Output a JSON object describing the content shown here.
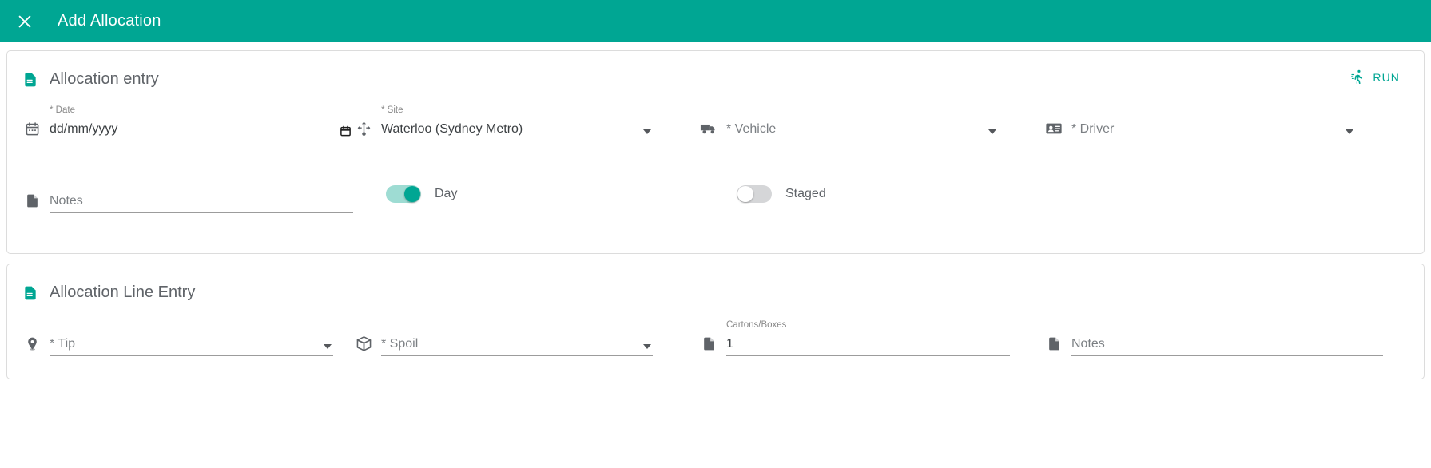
{
  "header": {
    "title": "Add Allocation",
    "close_icon": "close-icon",
    "background_color": "#00a693"
  },
  "allocation_entry": {
    "title": "Allocation entry",
    "section_icon": "document-icon",
    "run_button": {
      "label": "RUN",
      "icon": "running-person-icon",
      "color": "#00a693"
    },
    "fields": {
      "date": {
        "label": "* Date",
        "placeholder": "dd/mm/yyyy",
        "value": "",
        "icon": "calendar-icon",
        "picker_icon": "date-picker-icon"
      },
      "site": {
        "label": "* Site",
        "value": "Waterloo (Sydney Metro)",
        "placeholder": "* Site",
        "icon": "move-arrows-icon"
      },
      "vehicle": {
        "label": "",
        "value": "",
        "placeholder": "* Vehicle",
        "icon": "truck-icon"
      },
      "driver": {
        "label": "",
        "value": "",
        "placeholder": "* Driver",
        "icon": "id-badge-icon"
      },
      "notes": {
        "label": "",
        "value": "",
        "placeholder": "Notes",
        "icon": "note-icon"
      }
    },
    "toggles": {
      "day": {
        "label": "Day",
        "state": "on"
      },
      "staged": {
        "label": "Staged",
        "state": "off"
      }
    }
  },
  "allocation_line_entry": {
    "title": "Allocation Line Entry",
    "section_icon": "document-icon",
    "fields": {
      "tip": {
        "label": "",
        "value": "",
        "placeholder": "* Tip",
        "icon": "location-pin-icon"
      },
      "spoil": {
        "label": "",
        "value": "",
        "placeholder": "* Spoil",
        "icon": "box-icon"
      },
      "cartons_boxes": {
        "label": "Cartons/Boxes",
        "value": "1",
        "placeholder": "",
        "icon": "note-icon"
      },
      "notes": {
        "label": "",
        "value": "",
        "placeholder": "Notes",
        "icon": "note-icon"
      }
    }
  }
}
